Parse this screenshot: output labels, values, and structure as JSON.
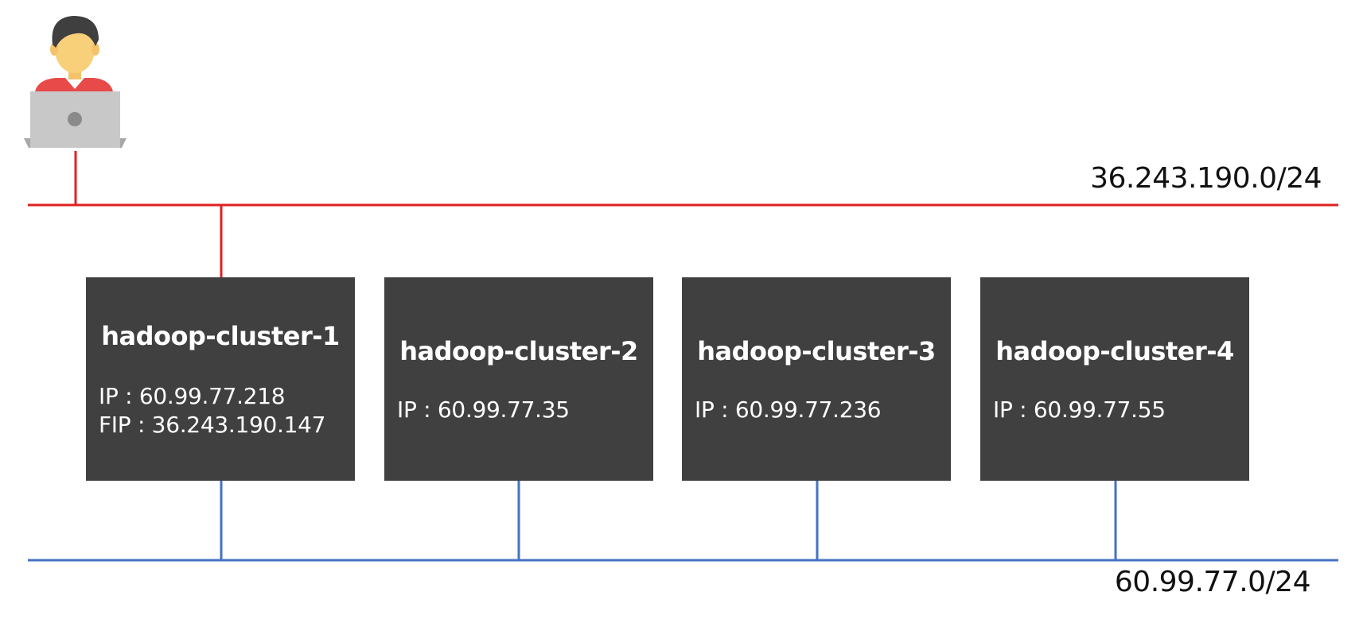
{
  "colors": {
    "public_network": "#e02020",
    "private_network": "#4472c4",
    "node_fill": "#404040",
    "node_text": "#ffffff"
  },
  "networks": {
    "public": {
      "cidr": "36.243.190.0/24"
    },
    "private": {
      "cidr": "60.99.77.0/24"
    }
  },
  "user": {
    "icon": "user-with-laptop-icon"
  },
  "nodes": [
    {
      "name": "hadoop-cluster-1",
      "ip_line": "IP : 60.99.77.218",
      "fip_line": "FIP : 36.243.190.147"
    },
    {
      "name": "hadoop-cluster-2",
      "ip_line": "IP : 60.99.77.35"
    },
    {
      "name": "hadoop-cluster-3",
      "ip_line": "IP : 60.99.77.236"
    },
    {
      "name": "hadoop-cluster-4",
      "ip_line": "IP : 60.99.77.55"
    }
  ]
}
